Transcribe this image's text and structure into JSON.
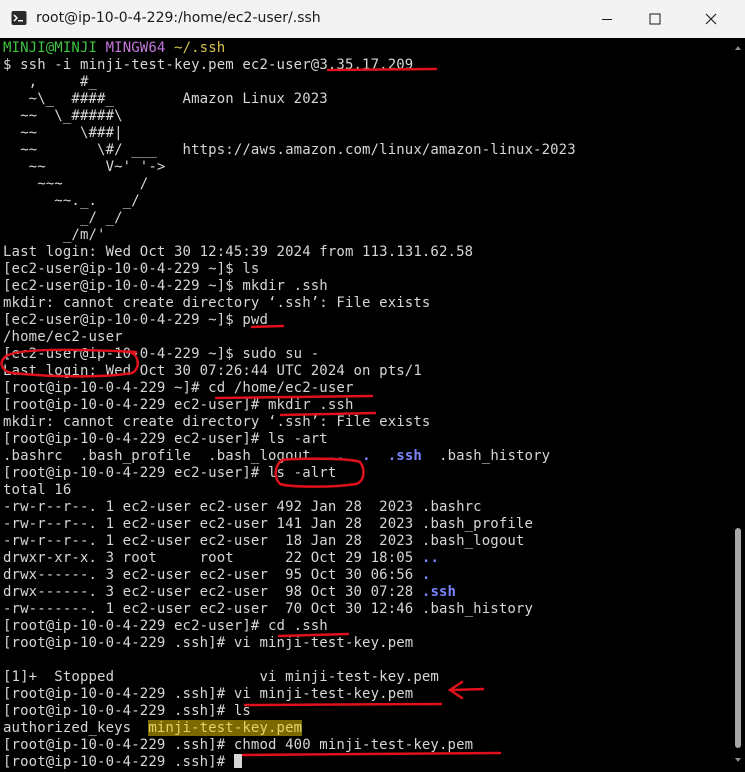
{
  "window": {
    "title": "root@ip-10-0-4-229:/home/ec2-user/.ssh",
    "icons": [
      "git-bash-icon",
      "minimize-icon",
      "maximize-icon",
      "close-icon"
    ]
  },
  "terminal": {
    "prompt_user": "MINJI@MINJI",
    "prompt_env": "MINGW64",
    "prompt_path": "~/.ssh",
    "ssh_cmd": "$ ssh -i minji-test-key.pem ec2-user@",
    "ssh_ip": "3.35.17.209",
    "banner": [
      "   ,     #_",
      "   ~\\_  ####_        Amazon Linux 2023",
      "  ~~  \\_#####\\",
      "  ~~     \\###|",
      "  ~~       \\#/ ___   https://aws.amazon.com/linux/amazon-linux-2023",
      "   ~~       V~' '->",
      "    ~~~         /",
      "      ~~._.   _/",
      "         _/ _/",
      "       _/m/'"
    ],
    "last_login_1": "Last login: Wed Oct 30 12:45:39 2024 from 113.131.62.58",
    "cmd_ls": "[ec2-user@ip-10-0-4-229 ~]$ ls",
    "cmd_mkdir": "[ec2-user@ip-10-0-4-229 ~]$ mkdir .ssh",
    "mkdir_err_1": "mkdir: cannot create directory ‘.ssh’: File exists",
    "cmd_pwd": "[ec2-user@ip-10-0-4-229 ~]$ pwd",
    "pwd_out": "/home/ec2-user",
    "cmd_sudo": "[ec2-user@ip-10-0-4-229 ~]$ sudo su -",
    "last_login_2": "Last login: Wed Oct 30 07:26:44 UTC 2024 on pts/1",
    "cmd_cd_home": "[root@ip-10-0-4-229 ~]# cd /home/ec2-user",
    "cmd_mkdir_root": "[root@ip-10-0-4-229 ec2-user]# mkdir .ssh",
    "mkdir_err_2": "mkdir: cannot create directory ‘.ssh’: File exists",
    "cmd_ls_art": "[root@ip-10-0-4-229 ec2-user]# ls -art",
    "ls_art_plain": ".bashrc  .bash_profile  .bash_logout  ",
    "ls_art_dotdot": "..",
    "ls_art_sp1": "  ",
    "ls_art_dot": ".",
    "ls_art_sp2": "  ",
    "ls_art_ssh": ".ssh",
    "ls_art_tail": "  .bash_history",
    "cmd_ls_alrt": "[root@ip-10-0-4-229 ec2-user]# ls -alrt",
    "total": "total 16",
    "listing": [
      {
        "meta": "-rw-r--r--. 1 ec2-user ec2-user 492 Jan 28  2023 ",
        "name": ".bashrc",
        "dir": false
      },
      {
        "meta": "-rw-r--r--. 1 ec2-user ec2-user 141 Jan 28  2023 ",
        "name": ".bash_profile",
        "dir": false
      },
      {
        "meta": "-rw-r--r--. 1 ec2-user ec2-user  18 Jan 28  2023 ",
        "name": ".bash_logout",
        "dir": false
      },
      {
        "meta": "drwxr-xr-x. 3 root     root      22 Oct 29 18:05 ",
        "name": "..",
        "dir": true
      },
      {
        "meta": "drwx------. 3 ec2-user ec2-user  95 Oct 30 06:56 ",
        "name": ".",
        "dir": true
      },
      {
        "meta": "drwx------. 3 ec2-user ec2-user  98 Oct 30 07:28 ",
        "name": ".ssh",
        "dir": true
      },
      {
        "meta": "-rw-------. 1 ec2-user ec2-user  70 Oct 30 12:46 ",
        "name": ".bash_history",
        "dir": false
      }
    ],
    "cmd_cd_ssh": "[root@ip-10-0-4-229 ec2-user]# cd .ssh",
    "cmd_vi_1": "[root@ip-10-0-4-229 .ssh]# vi minji-test-key.pem",
    "stopped": "[1]+  Stopped                 vi minji-test-key.pem",
    "cmd_vi_2": "[root@ip-10-0-4-229 .ssh]# vi minji-test-key.pem",
    "cmd_ls_2": "[root@ip-10-0-4-229 .ssh]# ls",
    "ls2_a": "authorized_keys  ",
    "ls2_key": "minji-test-key.pem",
    "cmd_chmod": "[root@ip-10-0-4-229 .ssh]# chmod 400 minji-test-key.pem",
    "cmd_last": "[root@ip-10-0-4-229 .ssh]# "
  },
  "colors": {
    "prompt_green": "#3fc43f",
    "prompt_purple": "#c677dd",
    "path_yellow": "#d8c64a",
    "dir_blue": "#7c86ff",
    "annotation_red": "#e0101c"
  }
}
